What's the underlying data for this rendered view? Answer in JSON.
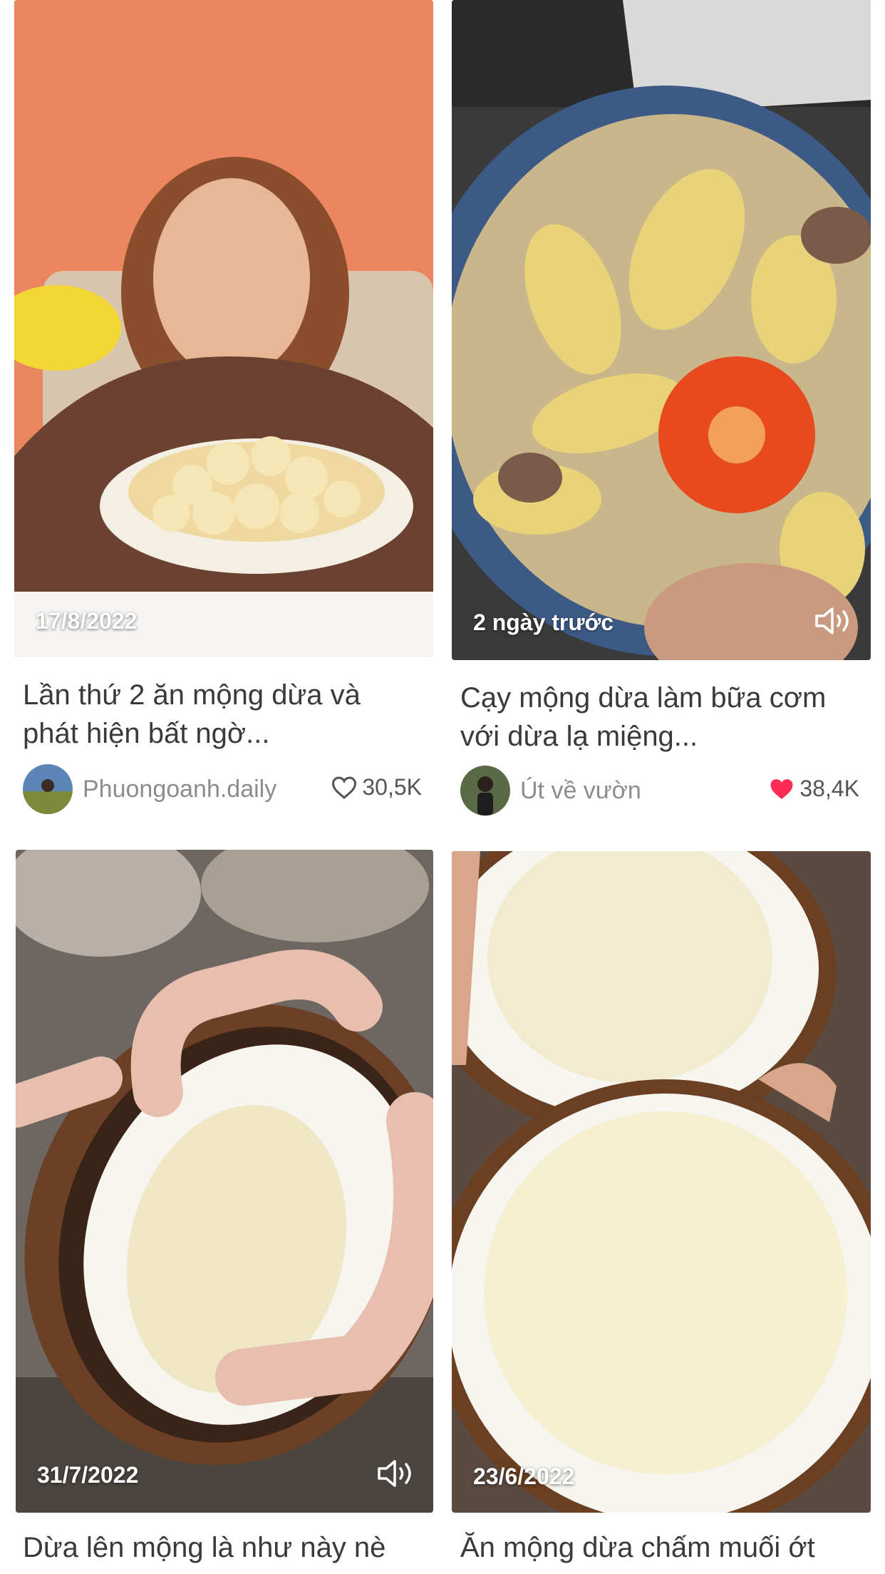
{
  "feed": {
    "cards": [
      {
        "date": "17/8/2022",
        "title_line1": "Lần thứ 2 ăn mộng dừa và",
        "title_line2": "phát hiện bất ngờ...",
        "author": "Phuongoanh.daily",
        "likes": "30,5K",
        "liked": false,
        "sound_icon": false
      },
      {
        "date": "2 ngày trước",
        "title_line1": "Cạy mộng dừa làm bữa cơm",
        "title_line2": "với dừa lạ miệng...",
        "author": "Út về vườn",
        "likes": "38,4K",
        "liked": true,
        "sound_icon": true
      },
      {
        "date": "31/7/2022",
        "title_line1": "Dừa lên mộng là như này nè",
        "sound_icon": true
      },
      {
        "date": "23/6/2022",
        "title_line1": "Ăn mộng dừa chấm muối ớt",
        "sound_icon": false
      }
    ]
  },
  "colors": {
    "liked_heart": "#fe2c55",
    "text_title": "#3a3a3a",
    "text_author": "#8c8c8c"
  }
}
